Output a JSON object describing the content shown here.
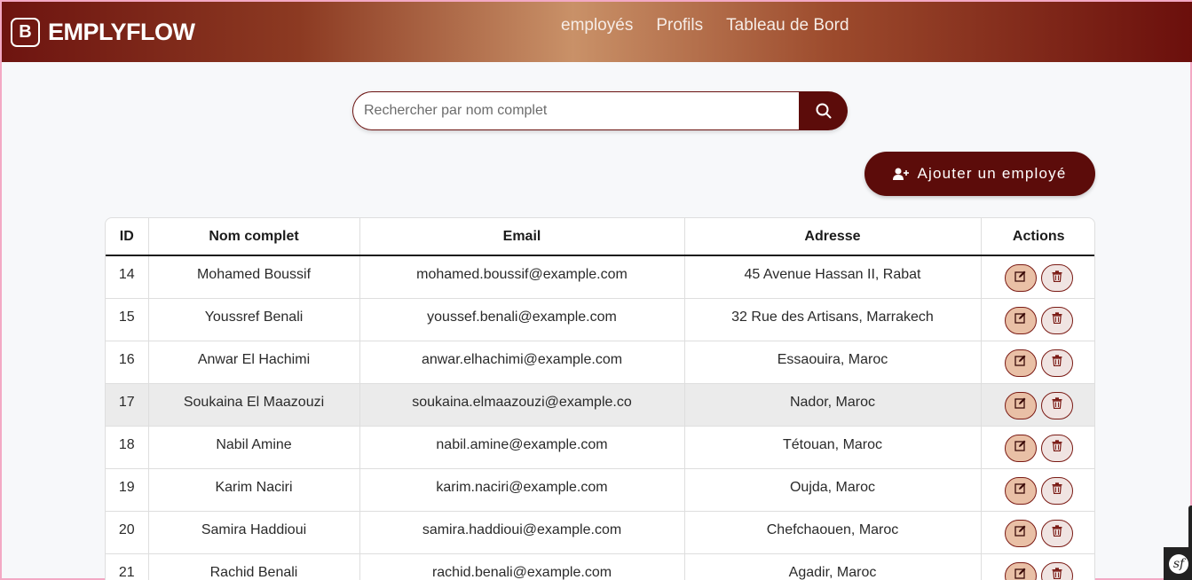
{
  "navbar": {
    "brand_logo": "B",
    "brand_name": "EMPLYFLOW",
    "links": [
      "employés",
      "Profils",
      "Tableau de Bord"
    ]
  },
  "search": {
    "placeholder": "Rechercher par nom complet",
    "icon": "search-icon"
  },
  "add_button": {
    "label": "Ajouter un employé",
    "icon": "user-plus-icon"
  },
  "table": {
    "headers": [
      "ID",
      "Nom complet",
      "Email",
      "Adresse",
      "Actions"
    ],
    "rows": [
      {
        "id": "14",
        "name": "Mohamed Boussif",
        "email": "mohamed.boussif@example.com",
        "address": "45 Avenue Hassan II, Rabat"
      },
      {
        "id": "15",
        "name": "Youssref Benali",
        "email": "youssef.benali@example.com",
        "address": "32 Rue des Artisans, Marrakech"
      },
      {
        "id": "16",
        "name": "Anwar El Hachimi",
        "email": "anwar.elhachimi@example.com",
        "address": "Essaouira, Maroc"
      },
      {
        "id": "17",
        "name": "Soukaina El Maazouzi",
        "email": "soukaina.elmaazouzi@example.co",
        "address": "Nador, Maroc"
      },
      {
        "id": "18",
        "name": "Nabil Amine",
        "email": "nabil.amine@example.com",
        "address": "Tétouan, Maroc"
      },
      {
        "id": "19",
        "name": "Karim Naciri",
        "email": "karim.naciri@example.com",
        "address": "Oujda, Maroc"
      },
      {
        "id": "20",
        "name": "Samira Haddioui",
        "email": "samira.haddioui@example.com",
        "address": "Chefchaouen, Maroc"
      },
      {
        "id": "21",
        "name": "Rachid Benali",
        "email": "rachid.benali@example.com",
        "address": "Agadir, Maroc"
      }
    ],
    "highlighted_row": 3,
    "row_actions": [
      "edit-icon",
      "trash-icon"
    ]
  },
  "debug_toolbar": {
    "logo": "sf"
  },
  "colors": {
    "primary": "#5c0c0a",
    "edit_button": "#e9c0a6",
    "delete_button": "#f0e4e2",
    "row_highlight": "#ebebeb"
  }
}
